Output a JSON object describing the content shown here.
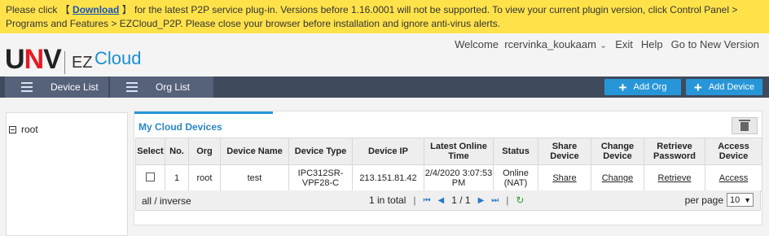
{
  "banner": {
    "prefix": "Please click 【 ",
    "download_label": "Download",
    "suffix": " 】 for the latest P2P service plug-in. Versions before 1.16.0001 will not be supported. To view your current plugin version, click Control Panel > Programs and Features > EZCloud_P2P. Please close your browser before installation and ignore anti-virus alerts."
  },
  "brand": {
    "logo_left": "U",
    "logo_mid": "N",
    "logo_right": "V",
    "product_ez": "EZ",
    "product_cloud": "Cloud"
  },
  "userbar": {
    "welcome": "Welcome",
    "username": "rcervinka_koukaam",
    "exit": "Exit",
    "help": "Help",
    "new_version": "Go to New Version"
  },
  "nav": {
    "tabs": [
      {
        "label": "Device List"
      },
      {
        "label": "Org List"
      }
    ],
    "add_org": "Add Org",
    "add_device": "Add Device"
  },
  "tree": {
    "root": "root"
  },
  "main": {
    "title": "My Cloud Devices",
    "columns": [
      "Select",
      "No.",
      "Org",
      "Device Name",
      "Device Type",
      "Device IP",
      "Latest Online Time",
      "Status",
      "Share Device",
      "Change Device",
      "Retrieve Password",
      "Access Device"
    ],
    "rows": [
      {
        "no": "1",
        "org": "root",
        "name": "test",
        "type": "IPC312SR-VPF28-C",
        "ip": "213.151.81.42",
        "online_time": "2/4/2020 3:07:53 PM",
        "status": "Online (NAT)",
        "share": "Share",
        "change": "Change",
        "retrieve": "Retrieve",
        "access": "Access"
      }
    ],
    "footer": {
      "select_all": "all / inverse",
      "total": "1 in total",
      "page": "1 / 1",
      "per_page_label": "per page",
      "per_page_value": "10"
    }
  },
  "colors": {
    "banner": "#ffe24a",
    "nav": "#3f4a5d",
    "accent": "#2796d8",
    "brand_red": "#e41b23"
  }
}
